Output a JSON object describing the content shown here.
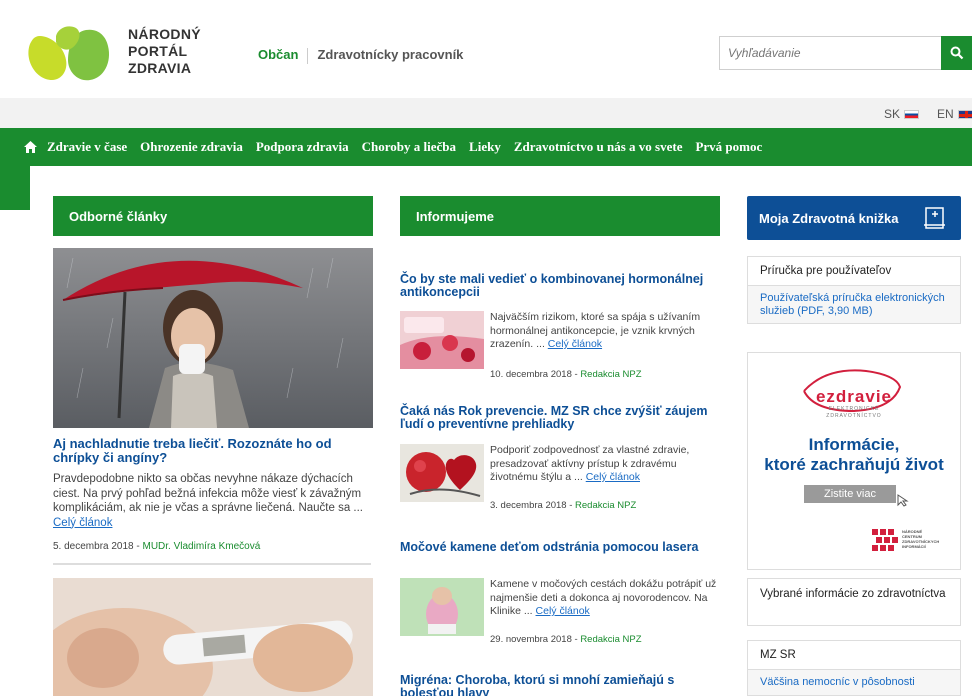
{
  "header": {
    "logo_line1": "NÁRODNÝ",
    "logo_line2": "PORTÁL",
    "logo_line3": "ZDRAVIA",
    "audience_active": "Občan",
    "audience_other": "Zdravotnícky pracovník",
    "search_placeholder": "Vyhľadávanie",
    "search_icon": "search-icon"
  },
  "languages": [
    {
      "code": "SK"
    },
    {
      "code": "EN"
    }
  ],
  "nav": {
    "items": [
      "Zdravie v čase",
      "Ohrozenie zdravia",
      "Podpora zdravia",
      "Choroby a liečba",
      "Lieky",
      "Zdravotníctvo u nás a vo svete",
      "Prvá pomoc"
    ]
  },
  "columns": {
    "left_head": "Odborné články",
    "middle_head": "Informujeme",
    "right_head": "Moja Zdravotná knižka"
  },
  "left_article": {
    "title": "Aj nachladnutie treba liečiť. Rozoznáte ho od chrípky či angíny?",
    "text": "Pravdepodobne nikto sa občas nevyhne nákaze dýchacích ciest. Na prvý pohľad bežná infekcia môže viesť k závažným komplikáciám, ak nie je včas a správne liečená. Naučte sa ...",
    "more": "Celý článok",
    "date": "5. decembra 2018 - ",
    "author": "MUDr. Vladimíra Kmečová"
  },
  "middle_articles": [
    {
      "title": "Čo by ste mali vedieť o kombinovanej hormonálnej antikoncepcii",
      "text": "Najväčším rizikom, ktoré sa spája s užívaním hormonálnej antikoncepcie, je vznik krvných zrazenín. ...",
      "more": "Celý článok",
      "date": "10. decembra 2018 - ",
      "author": "Redakcia NPZ"
    },
    {
      "title": "Čaká nás Rok prevencie. MZ SR chce zvýšiť záujem ľudí o preventívne prehliadky",
      "text": "Podporiť zodpovednosť za vlastné zdravie, presadzovať aktívny prístup k zdravému životnému štýlu a ...",
      "more": "Celý článok",
      "date": "3. decembra 2018 - ",
      "author": "Redakcia NPZ"
    },
    {
      "title": "Močové kamene deťom odstránia pomocou lasera",
      "text": "Kamene v močových cestách dokážu potrápiť už najmenšie deti a dokonca aj novorodencov. Na Klinike ...",
      "more": "Celý článok",
      "date": "29. novembra 2018 - ",
      "author": "Redakcia NPZ"
    },
    {
      "title": "Migréna: Choroba, ktorú si mnohí zamieňajú s bolesťou hlavy",
      "text": "",
      "more": "",
      "date": "",
      "author": ""
    }
  ],
  "right": {
    "manual_title": "Príručka pre používateľov",
    "manual_link": "Používateľská príručka elektronických služieb (PDF, 3,90 MB)",
    "promo_logo": "ezdravie",
    "promo_logo_sub1": "ELEKTRONICKÉ",
    "promo_logo_sub2": "ZDRAVOTNÍCTVO",
    "promo_title_1": "Informácie,",
    "promo_title_2": "ktoré zachraňujú život",
    "promo_button": "Zistite viac",
    "ncz_1": "NÁRODNÉ",
    "ncz_2": "CENTRUM",
    "ncz_3": "ZDRAVOTNÍCKYCH",
    "ncz_4": "INFORMÁCIÍ",
    "selected_title": "Vybrané informácie zo zdravotníctva",
    "mzsr_title": "MZ SR",
    "mzsr_link": "Väčšina nemocníc v pôsobnosti"
  },
  "colors": {
    "green": "#1a8c2f",
    "blue": "#0d4f96",
    "link": "#1a6bc4"
  }
}
